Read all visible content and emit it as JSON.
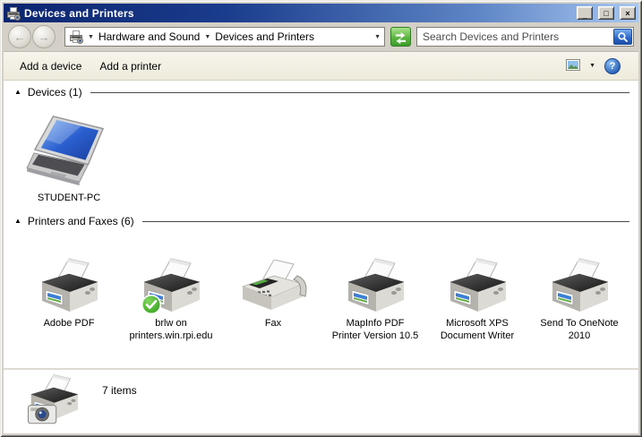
{
  "window": {
    "title": "Devices and Printers"
  },
  "navbar": {
    "breadcrumb": {
      "parent": "Hardware and Sound",
      "current": "Devices and Printers"
    },
    "search_placeholder": "Search Devices and Printers"
  },
  "toolbar": {
    "add_device": "Add a device",
    "add_printer": "Add a printer"
  },
  "sections": {
    "devices": "Devices (1)",
    "printers": "Printers and Faxes (6)"
  },
  "devices": [
    {
      "label": "STUDENT-PC",
      "type": "laptop"
    }
  ],
  "printers": [
    {
      "label": "Adobe PDF",
      "type": "printer",
      "default": false
    },
    {
      "label": "brlw on printers.win.rpi.edu",
      "type": "printer",
      "default": true
    },
    {
      "label": "Fax",
      "type": "fax",
      "default": false
    },
    {
      "label": "MapInfo PDF Printer Version 10.5",
      "type": "printer",
      "default": false
    },
    {
      "label": "Microsoft XPS Document Writer",
      "type": "printer",
      "default": false
    },
    {
      "label": "Send To OneNote 2010",
      "type": "printer",
      "default": false
    }
  ],
  "statusbar": {
    "count": "7 items"
  },
  "icons": {
    "window_icon": "devices-and-printers-icon",
    "title_buttons": [
      "minimize-icon",
      "maximize-icon",
      "close-icon"
    ],
    "nav": [
      "back-icon",
      "forward-icon",
      "chevron-down-icon",
      "refresh-icon",
      "search-icon"
    ],
    "toolbar": [
      "views-icon",
      "chevron-down-icon",
      "help-icon"
    ],
    "items": [
      "laptop-icon",
      "printer-icon",
      "fax-icon",
      "default-check-icon",
      "printer-camera-icon"
    ]
  },
  "colors": {
    "titlebar_left": "#0B2570",
    "titlebar_right": "#A8C7F0",
    "chrome_gray": "#D4D0C8",
    "toolbar_bg": "#F2F0E4",
    "default_badge_green": "#2F9E1A",
    "refresh_green": "#48A834",
    "search_button_blue": "#2A66C8",
    "help_blue": "#2A63B8",
    "screen_blue": "#2A5FD0"
  }
}
